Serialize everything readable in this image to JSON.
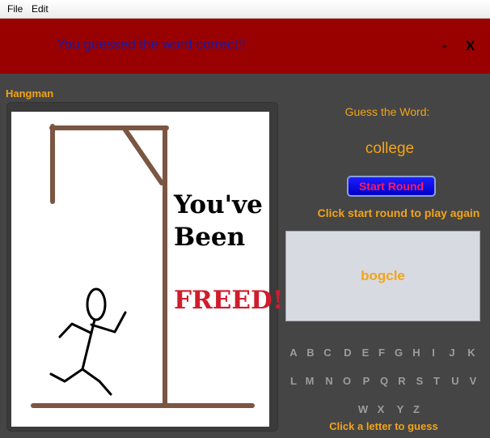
{
  "menu": {
    "file": "File",
    "edit": "Edit"
  },
  "banner": {
    "message": "You guessed the word correct!!",
    "minimize": "-",
    "close": "X"
  },
  "panel_title": "Hangman",
  "image": {
    "line1": "You've",
    "line2": "Been",
    "line3": "FREED!"
  },
  "guess_label": "Guess the Word:",
  "word": "college",
  "start_button": "Start Round",
  "instructions": "Click start round to play again",
  "current_guess": "bogcle",
  "letters": {
    "A": "A",
    "B": "B",
    "C": "C",
    "D": "D",
    "E": "E",
    "F": "F",
    "G": "G",
    "H": "H",
    "I": "I",
    "J": "J",
    "K": "K",
    "L": "L",
    "M": "M",
    "N": "N",
    "O": "O",
    "P": "P",
    "Q": "Q",
    "R": "R",
    "S": "S",
    "T": "T",
    "U": "U",
    "V": "V",
    "W": "W",
    "X": "X",
    "Y": "Y",
    "Z": "Z"
  },
  "letter_hint": "Click a letter to guess",
  "colors": {
    "banner": "#990000",
    "accent": "#f2a418",
    "background": "#454545",
    "letter_disabled": "#9c9c9c"
  }
}
